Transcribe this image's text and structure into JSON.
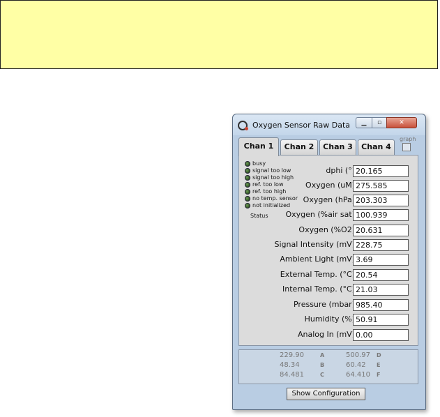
{
  "window": {
    "title": "Oxygen Sensor Raw Data"
  },
  "tabs": [
    "Chan 1",
    "Chan 2",
    "Chan 3",
    "Chan 4"
  ],
  "active_tab": 0,
  "graph_label": "graph",
  "status": {
    "label": "Status",
    "leds": [
      "busy",
      "signal too low",
      "signal too high",
      "ref. too low",
      "ref. too high",
      "no temp. sensor",
      "not initialized"
    ]
  },
  "fields": [
    {
      "label": "dphi (°)",
      "value": "20.165"
    },
    {
      "label": "Oxygen (uM)",
      "value": "275.585"
    },
    {
      "label": "Oxygen (hPa)",
      "value": "203.303"
    },
    {
      "label": "Oxygen (%air sat)",
      "value": "100.939"
    },
    {
      "label": "Oxygen (%O2)",
      "value": "20.631"
    },
    {
      "label": "Signal Intensity (mV)",
      "value": "228.75"
    },
    {
      "label": "Ambient Light (mV)",
      "value": "3.69"
    },
    {
      "label": "External Temp. (°C)",
      "value": "20.54"
    },
    {
      "label": "Internal Temp. (°C)",
      "value": "21.03"
    },
    {
      "label": "Pressure (mbar)",
      "value": "985.40"
    },
    {
      "label": "Humidity (%)",
      "value": "50.91"
    },
    {
      "label": "Analog In (mV)",
      "value": "0.00"
    }
  ],
  "raw": {
    "left": [
      {
        "value": "229.90",
        "letter": "A"
      },
      {
        "value": "48.34",
        "letter": "B"
      },
      {
        "value": "84.481",
        "letter": "C"
      }
    ],
    "right": [
      {
        "value": "500.97",
        "letter": "D"
      },
      {
        "value": "60.42",
        "letter": "E"
      },
      {
        "value": "64.410",
        "letter": "F"
      }
    ]
  },
  "buttons": {
    "show_configuration": "Show Configuration"
  }
}
